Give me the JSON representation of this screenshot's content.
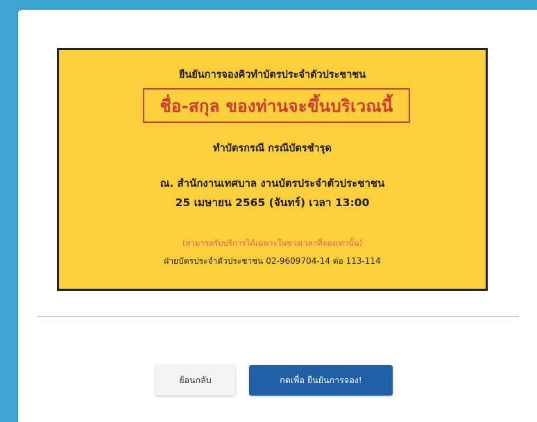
{
  "ticket": {
    "heading": "ยืนยันการจองคิวทำบัตรประจำตัวประชาชน",
    "name_placeholder": "ชื่อ-สกุล ของท่านจะขึ้นบริเวณนี้",
    "service": "ทำบัตรกรณี กรณีบัตรชำรุด",
    "location": "ณ. สำนักงานเทศบาล งานบัตรประจำตัวประชาชน",
    "datetime": "25 เมษายน 2565 (จันทร์) เวลา 13:00",
    "note": "(สามารถรับบริการได้เฉพาะในช่วงเวลาที่จองเท่านั้น)",
    "contact": "ฝ่ายบัตรประจำตัวประชาชน 02-9609704-14 ต่อ 113-114"
  },
  "actions": {
    "back_label": "ย้อนกลับ",
    "confirm_label": "กดเพื่อ ยืนยันการจอง!"
  },
  "colors": {
    "page_background": "#3fa6d4",
    "ticket_background": "#fcd03c",
    "name_highlight": "#cf3a2e",
    "note_text": "#e0605a",
    "confirm_button": "#1f5fa3"
  }
}
